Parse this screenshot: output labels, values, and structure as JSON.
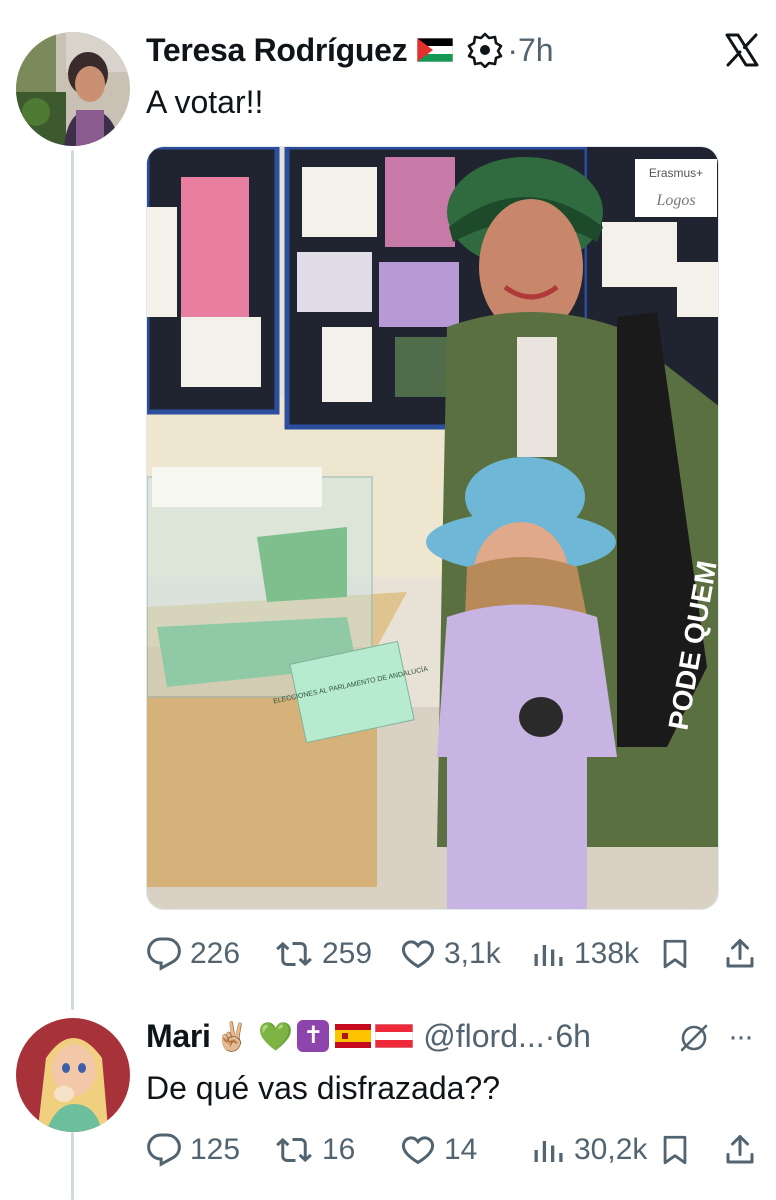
{
  "tweet": {
    "author_name": "Teresa Rodríguez",
    "flag": "palestine-flag",
    "verified_icon": "affiliate-badge-icon",
    "separator": "·",
    "time": "7h",
    "text": "A votar!!",
    "photo_ballot_label": "ELECCIONES AL PARLAMENTO DE ANDALUCÍA",
    "photo_poster_label": "Erasmus+",
    "photo_poster_sub": "Logos",
    "photo_bag_text": "PODE QUEM",
    "stats": {
      "replies": "226",
      "reposts": "259",
      "likes": "3,1k",
      "views": "138k"
    }
  },
  "reply": {
    "author_name": "Mari",
    "emojis": "✌🏼 💚",
    "badge": "✝",
    "flags": [
      "spain-flag",
      "austria-flag"
    ],
    "handle": "@flord...",
    "separator": "·",
    "time": "6h",
    "text": "De qué vas disfrazada??",
    "stats": {
      "replies": "125",
      "reposts": "16",
      "likes": "14",
      "views": "30,2k"
    }
  },
  "colors": {
    "text": "#0f1419",
    "muted": "#536471",
    "thread_line": "#cfd9de"
  },
  "icons": [
    "x-logo-icon",
    "reply-icon",
    "repost-icon",
    "like-icon",
    "views-icon",
    "bookmark-icon",
    "share-icon",
    "more-icon",
    "no-reply-icon"
  ]
}
